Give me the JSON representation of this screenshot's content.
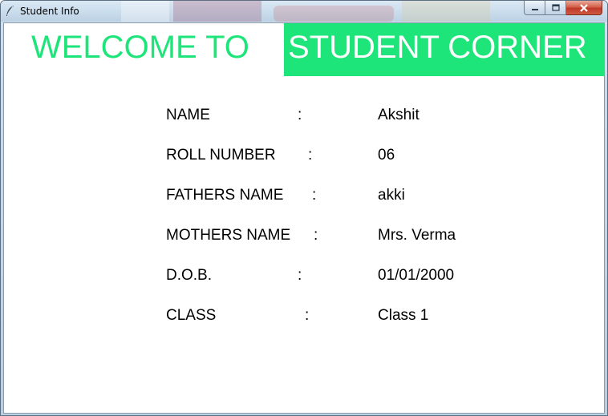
{
  "window": {
    "title": "Student Info",
    "icon": "feather-icon",
    "controls": {
      "minimize": "minimize-icon",
      "maximize": "maximize-icon",
      "close": "close-icon"
    }
  },
  "header": {
    "welcome_text": "WELCOME TO",
    "banner_text": "STUDENT CORNER",
    "accent_color": "#1ee57a"
  },
  "student": {
    "rows": [
      {
        "label": "NAME",
        "colon": ":",
        "value": "Akshit"
      },
      {
        "label": "ROLL NUMBER",
        "colon": ":",
        "value": "06"
      },
      {
        "label": "FATHERS NAME",
        "colon": ":",
        "value": "akki"
      },
      {
        "label": "MOTHERS NAME",
        "colon": ":",
        "value": "Mrs. Verma"
      },
      {
        "label": "D.O.B.",
        "colon": ":",
        "value": "01/01/2000"
      },
      {
        "label": "CLASS",
        "colon": ":",
        "value": "Class 1"
      }
    ]
  }
}
